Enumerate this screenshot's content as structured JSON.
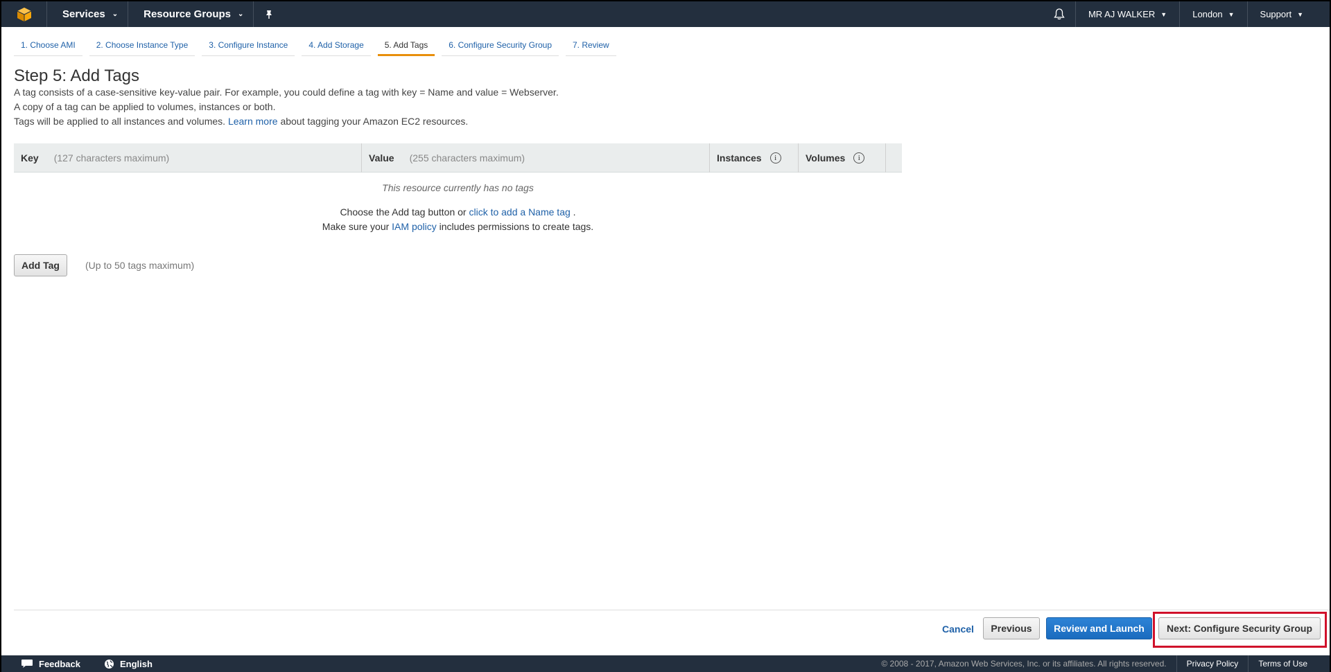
{
  "topbar": {
    "services_label": "Services",
    "resource_groups_label": "Resource Groups",
    "user_label": "MR AJ WALKER",
    "region_label": "London",
    "support_label": "Support",
    "logo_color": "#f7a80d"
  },
  "wizard": {
    "tabs": [
      {
        "label": "1. Choose AMI"
      },
      {
        "label": "2. Choose Instance Type"
      },
      {
        "label": "3. Configure Instance"
      },
      {
        "label": "4. Add Storage"
      },
      {
        "label": "5. Add Tags",
        "active": true
      },
      {
        "label": "6. Configure Security Group"
      },
      {
        "label": "7. Review"
      }
    ]
  },
  "content": {
    "title": "Step 5: Add Tags",
    "desc_line1": "A tag consists of a case-sensitive key-value pair. For example, you could define a tag with key = Name and value = Webserver.",
    "desc_line2": "A copy of a tag can be applied to volumes, instances or both.",
    "desc_line3_pre": "Tags will be applied to all instances and volumes. ",
    "desc_line3_link": "Learn more",
    "desc_line3_post": " about tagging your Amazon EC2 resources."
  },
  "table": {
    "key_header": "Key",
    "key_hint": "(127 characters maximum)",
    "value_header": "Value",
    "value_hint": "(255 characters maximum)",
    "instances_header": "Instances",
    "volumes_header": "Volumes",
    "info_glyph": "i",
    "empty_message": "This resource currently has no tags",
    "empty_line1_pre": "Choose the Add tag button or ",
    "empty_line1_link": "click to add a Name tag",
    "empty_line1_post": ".",
    "empty_line2_pre": "Make sure your ",
    "empty_line2_link": "IAM policy",
    "empty_line2_post": " includes permissions to create tags."
  },
  "add_tag": {
    "button_label": "Add Tag",
    "hint": "(Up to 50 tags maximum)"
  },
  "actions": {
    "cancel_label": "Cancel",
    "previous_label": "Previous",
    "review_label": "Review and Launch",
    "next_label": "Next: Configure Security Group",
    "highlight_color": "#d0112b"
  },
  "footer": {
    "feedback_label": "Feedback",
    "language_label": "English",
    "copyright": "© 2008 - 2017, Amazon Web Services, Inc. or its affiliates. All rights reserved.",
    "privacy_label": "Privacy Policy",
    "terms_label": "Terms of Use"
  }
}
